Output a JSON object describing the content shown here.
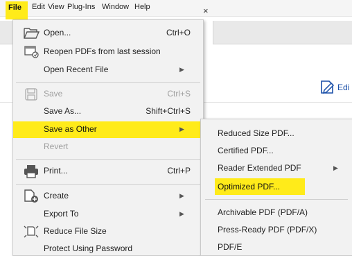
{
  "menubar": {
    "items": [
      "File",
      "Edit",
      "View",
      "Plug-Ins",
      "Window",
      "Help"
    ]
  },
  "background": {
    "tab_close": "×",
    "edit_label": "Edi"
  },
  "file_menu": {
    "open": {
      "label": "Open...",
      "shortcut": "Ctrl+O"
    },
    "reopen": {
      "label": "Reopen PDFs from last session"
    },
    "open_recent": {
      "label": "Open Recent File"
    },
    "save": {
      "label": "Save",
      "shortcut": "Ctrl+S"
    },
    "save_as": {
      "label": "Save As...",
      "shortcut": "Shift+Ctrl+S"
    },
    "save_as_other": {
      "label": "Save as Other"
    },
    "revert": {
      "label": "Revert"
    },
    "print": {
      "label": "Print...",
      "shortcut": "Ctrl+P"
    },
    "create": {
      "label": "Create"
    },
    "export_to": {
      "label": "Export To"
    },
    "reduce_file_size": {
      "label": "Reduce File Size"
    },
    "protect": {
      "label": "Protect Using Password"
    }
  },
  "save_as_other_menu": {
    "reduced_size": "Reduced Size PDF...",
    "certified": "Certified PDF...",
    "reader_extended": "Reader Extended PDF",
    "optimized": "Optimized PDF...",
    "archivable": "Archivable PDF (PDF/A)",
    "press_ready": "Press-Ready PDF (PDF/X)",
    "pdf_e": "PDF/E"
  },
  "colors": {
    "highlight": "#ffeb1a",
    "menu_bg": "#f2f2f2",
    "disabled_text": "#9e9e9e",
    "edit_accent": "#1a4fa8"
  },
  "icons": [
    "folder-open-icon",
    "reopen-pdf-icon",
    "save-disk-icon",
    "printer-icon",
    "create-pdf-icon",
    "reduce-file-size-icon",
    "submenu-arrow-icon",
    "edit-pdf-icon",
    "close-tab-icon"
  ]
}
